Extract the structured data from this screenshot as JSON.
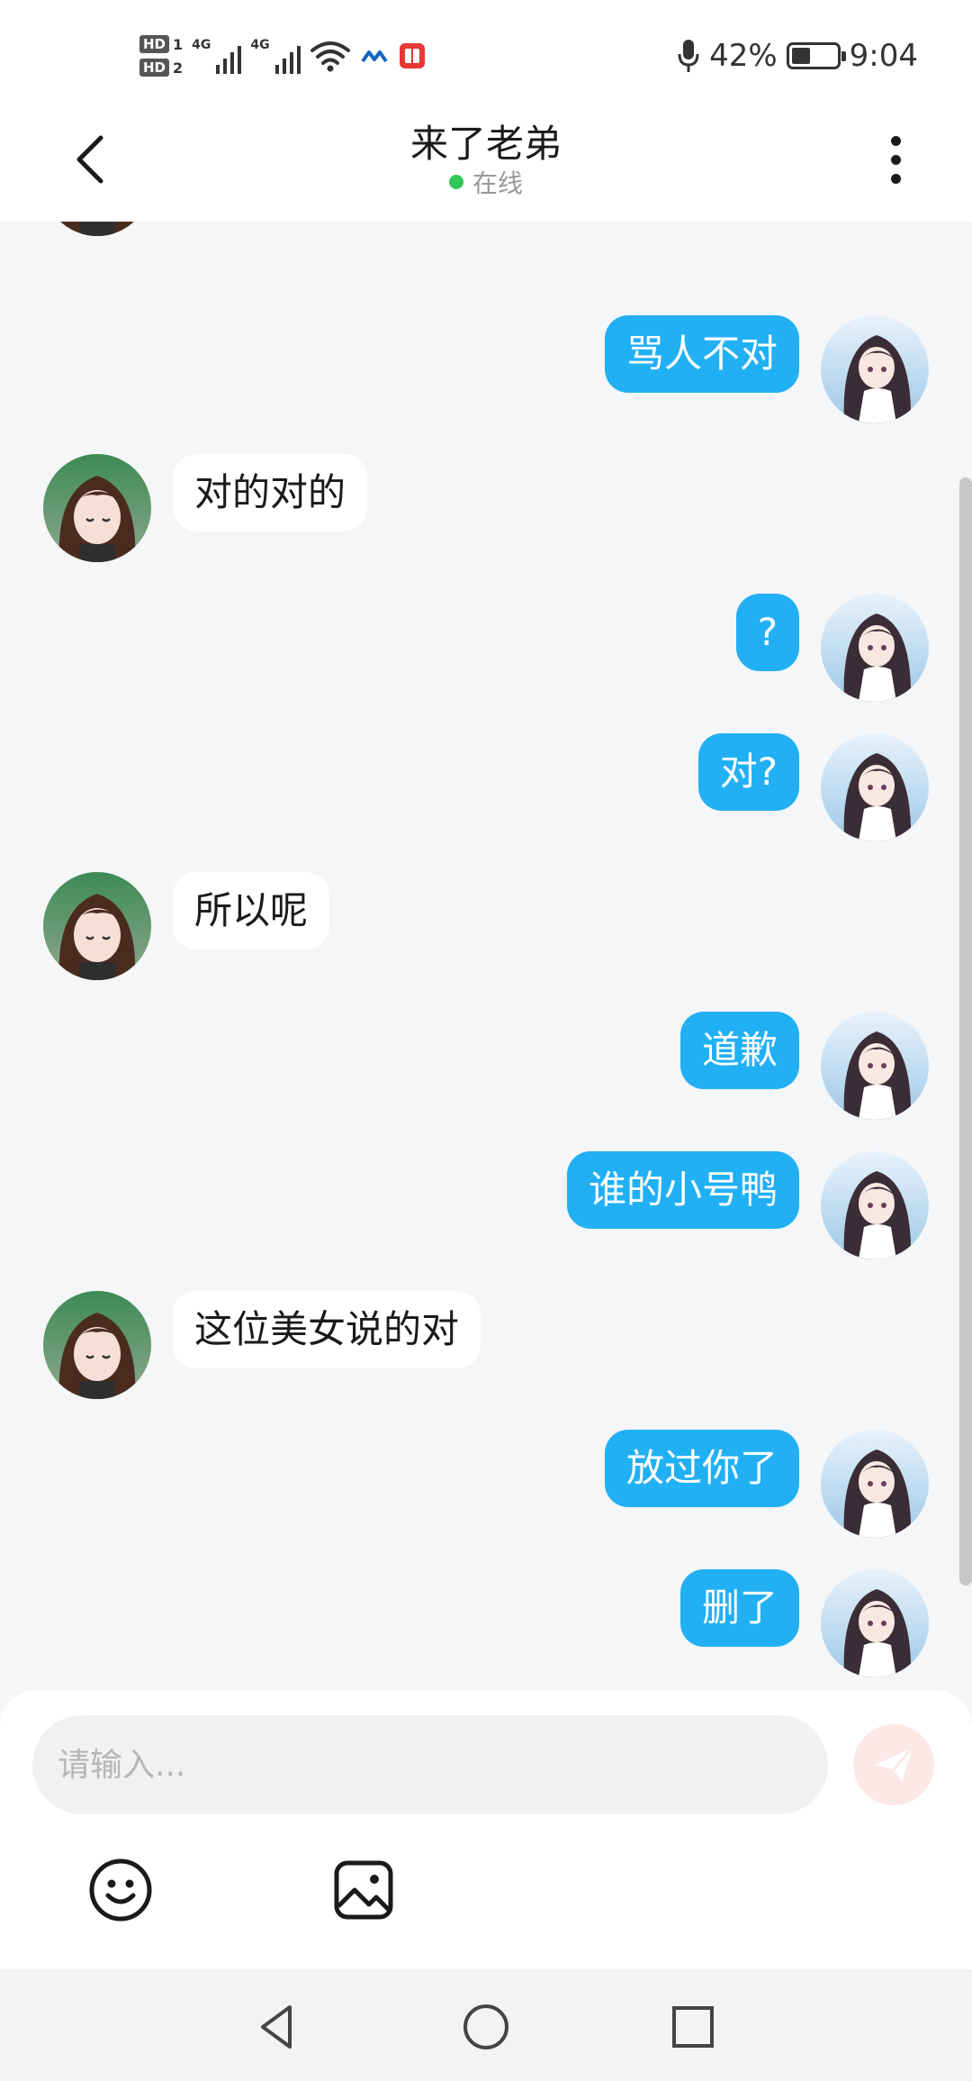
{
  "status_bar": {
    "sim1_label": "HD",
    "sim1_num": "1",
    "sim2_label": "HD",
    "sim2_num": "2",
    "net1": "4G",
    "net2": "4G",
    "battery_percent": "42%",
    "battery_level": 0.42,
    "time": "9:04"
  },
  "header": {
    "title": "来了老弟",
    "status": "在线",
    "status_color": "#34c759"
  },
  "messages": [
    {
      "side": "in",
      "text": "…………………"
    },
    {
      "side": "out",
      "text": "骂人不对"
    },
    {
      "side": "in",
      "text": "对的对的"
    },
    {
      "side": "out",
      "text": "?"
    },
    {
      "side": "out",
      "text": "对?"
    },
    {
      "side": "in",
      "text": "所以呢"
    },
    {
      "side": "out",
      "text": "道歉"
    },
    {
      "side": "out",
      "text": "谁的小号鸭"
    },
    {
      "side": "in",
      "text": "这位美女说的对"
    },
    {
      "side": "out",
      "text": "放过你了"
    },
    {
      "side": "out",
      "text": "删了"
    }
  ],
  "composer": {
    "placeholder": "请输入...",
    "send_icon": "paper-plane-icon",
    "tools": [
      "emoji-icon",
      "image-icon"
    ]
  },
  "nav": {
    "icons": [
      "back-triangle-icon",
      "home-circle-icon",
      "recents-square-icon"
    ]
  },
  "colors": {
    "outgoing_bubble": "#22b0f5",
    "incoming_bubble": "#ffffff",
    "background": "#f5f6f8"
  }
}
